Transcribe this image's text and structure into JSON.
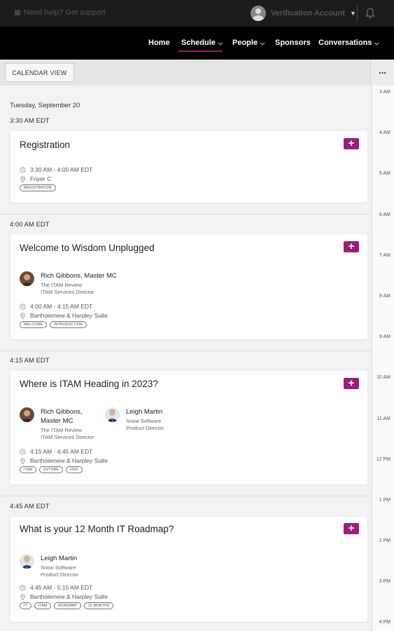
{
  "topbar": {
    "help_text": "Need help? Get support",
    "account_label": "Verification Account",
    "caret_icon": "chevron-down-icon",
    "bell_icon": "bell-icon"
  },
  "nav": {
    "items": [
      {
        "label": "Home",
        "has_menu": false
      },
      {
        "label": "Schedule",
        "has_menu": true,
        "active": true
      },
      {
        "label": "People",
        "has_menu": true
      },
      {
        "label": "Sponsors",
        "has_menu": false
      },
      {
        "label": "Conversations",
        "has_menu": true
      }
    ],
    "active_color": "#a0185f"
  },
  "toolbar": {
    "calendar_view_label": "CALENDAR VIEW",
    "more_label": "..."
  },
  "timeline": {
    "hours": [
      "3 AM",
      "4 AM",
      "5 AM",
      "6 AM",
      "7 AM",
      "8 AM",
      "9 AM",
      "10 AM",
      "11 AM",
      "12 PM",
      "1 PM",
      "2 PM",
      "3 PM",
      "4 PM"
    ]
  },
  "schedule": {
    "date": "Tuesday, September 20",
    "add_color": "#9b1e76",
    "add_label": "+",
    "groups": [
      {
        "time": "3:30 AM EDT",
        "session": {
          "title": "Registration",
          "speakers": [],
          "time_range": "3:30 AM - 4:00 AM EDT",
          "location": "Foyer C",
          "tags": [
            "REGISTRATION"
          ]
        }
      },
      {
        "time": "4:00 AM EDT",
        "session": {
          "title": "Welcome to Wisdom Unplugged",
          "speakers": [
            {
              "name": "Rich Gibbons, Master MC",
              "company": "The ITAM Review",
              "role": "ITAM Services Director"
            }
          ],
          "time_range": "4:00 AM - 4:15 AM EDT",
          "location": "Bartholemew & Harpley Suite",
          "tags": [
            "WELCOME",
            "INTRODUCTION"
          ]
        }
      },
      {
        "time": "4:15 AM EDT",
        "session": {
          "title": "Where is ITAM Heading in 2023?",
          "speakers": [
            {
              "name_line1": "Rich Gibbons,",
              "name_line2": "Master MC",
              "company": "The ITAM Review",
              "role": "ITAM Services Director"
            },
            {
              "name": "Leigh Martin",
              "company": "Snow Software",
              "role": "Product Director"
            }
          ],
          "time_range": "4:15 AM - 4:45 AM EDT",
          "location": "Bartholemew & Harpley Suite",
          "tags": [
            "ITAM",
            "FUTURE",
            "2023"
          ]
        }
      },
      {
        "time": "4:45 AM EDT",
        "session": {
          "title": "What is your 12 Month IT Roadmap?",
          "speakers": [
            {
              "name": "Leigh Martin",
              "company": "Snow Software",
              "role": "Product Director"
            }
          ],
          "time_range": "4:45 AM - 5:15 AM EDT",
          "location": "Bartholemew & Harpley Suite",
          "tags": [
            "IT",
            "ITAM",
            "ROADMAP",
            "12 MONTHS"
          ]
        }
      }
    ]
  }
}
